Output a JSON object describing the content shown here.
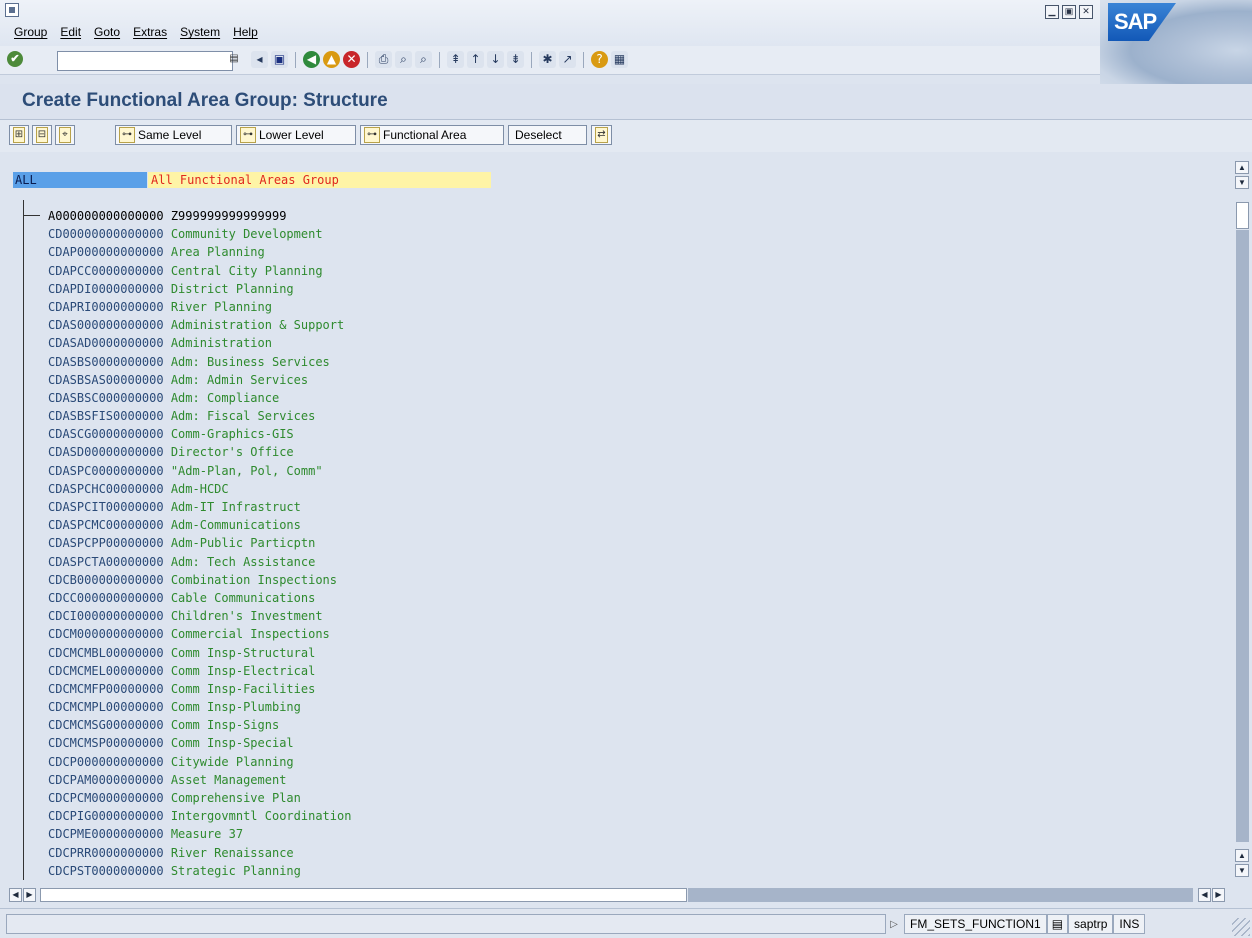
{
  "menu": {
    "items": [
      "Group",
      "Edit",
      "Goto",
      "Extras",
      "System",
      "Help"
    ]
  },
  "window_controls": [
    "minimize-icon",
    "maximize-icon",
    "close-icon"
  ],
  "logo": "SAP",
  "command_field": {
    "value": ""
  },
  "title": "Create Functional Area Group: Structure",
  "app_toolbar": {
    "same_level": "Same Level",
    "lower_level": "Lower Level",
    "functional_area": "Functional Area",
    "deselect": "Deselect"
  },
  "tree": {
    "root_key": "ALL",
    "root_desc": "All Functional Areas Group",
    "rows": [
      {
        "key": "A000000000000000 Z999999999999999",
        "desc": ""
      },
      {
        "key": "CD00000000000000",
        "desc": "Community Development"
      },
      {
        "key": "CDAP000000000000",
        "desc": "Area Planning"
      },
      {
        "key": "CDAPCC0000000000",
        "desc": "Central City Planning"
      },
      {
        "key": "CDAPDI0000000000",
        "desc": "District Planning"
      },
      {
        "key": "CDAPRI0000000000",
        "desc": "River Planning"
      },
      {
        "key": "CDAS000000000000",
        "desc": "Administration & Support"
      },
      {
        "key": "CDASAD0000000000",
        "desc": "Administration"
      },
      {
        "key": "CDASBS0000000000",
        "desc": "Adm: Business Services"
      },
      {
        "key": "CDASBSAS00000000",
        "desc": "Adm: Admin Services"
      },
      {
        "key": "CDASBSC000000000",
        "desc": "Adm: Compliance"
      },
      {
        "key": "CDASBSFIS0000000",
        "desc": "Adm: Fiscal Services"
      },
      {
        "key": "CDASCG0000000000",
        "desc": "Comm-Graphics-GIS"
      },
      {
        "key": "CDASD00000000000",
        "desc": "Director's Office"
      },
      {
        "key": "CDASPC0000000000",
        "desc": "\"Adm-Plan, Pol, Comm\""
      },
      {
        "key": "CDASPCHC00000000",
        "desc": "Adm-HCDC"
      },
      {
        "key": "CDASPCIT00000000",
        "desc": "Adm-IT Infrastruct"
      },
      {
        "key": "CDASPCMC00000000",
        "desc": "Adm-Communications"
      },
      {
        "key": "CDASPCPP00000000",
        "desc": "Adm-Public Particptn"
      },
      {
        "key": "CDASPCTA00000000",
        "desc": "Adm: Tech Assistance"
      },
      {
        "key": "CDCB000000000000",
        "desc": "Combination Inspections"
      },
      {
        "key": "CDCC000000000000",
        "desc": "Cable Communications"
      },
      {
        "key": "CDCI000000000000",
        "desc": "Children's Investment"
      },
      {
        "key": "CDCM000000000000",
        "desc": "Commercial Inspections"
      },
      {
        "key": "CDCMCMBL00000000",
        "desc": "Comm Insp-Structural"
      },
      {
        "key": "CDCMCMEL00000000",
        "desc": "Comm Insp-Electrical"
      },
      {
        "key": "CDCMCMFP00000000",
        "desc": "Comm Insp-Facilities"
      },
      {
        "key": "CDCMCMPL00000000",
        "desc": "Comm Insp-Plumbing"
      },
      {
        "key": "CDCMCMSG00000000",
        "desc": "Comm Insp-Signs"
      },
      {
        "key": "CDCMCMSP00000000",
        "desc": "Comm Insp-Special"
      },
      {
        "key": "CDCP000000000000",
        "desc": "Citywide Planning"
      },
      {
        "key": "CDCPAM0000000000",
        "desc": "Asset Management"
      },
      {
        "key": "CDCPCM0000000000",
        "desc": "Comprehensive Plan"
      },
      {
        "key": "CDCPIG0000000000",
        "desc": "Intergovmntl Coordination"
      },
      {
        "key": "CDCPME0000000000",
        "desc": "Measure 37"
      },
      {
        "key": "CDCPRR0000000000",
        "desc": "River Renaissance"
      },
      {
        "key": "CDCPST0000000000",
        "desc": "Strategic Planning"
      }
    ]
  },
  "status": {
    "message": "",
    "transaction": "FM_SETS_FUNCTION1",
    "server": "saptrp",
    "mode": "INS"
  },
  "colors": {
    "title": "#2d4d78",
    "tree_key": "#2a4a78",
    "tree_desc": "#2e8a2e",
    "root_key_bg": "#5aa0e8",
    "root_desc_bg": "#fef4a6",
    "root_desc_text": "#e0281e"
  }
}
